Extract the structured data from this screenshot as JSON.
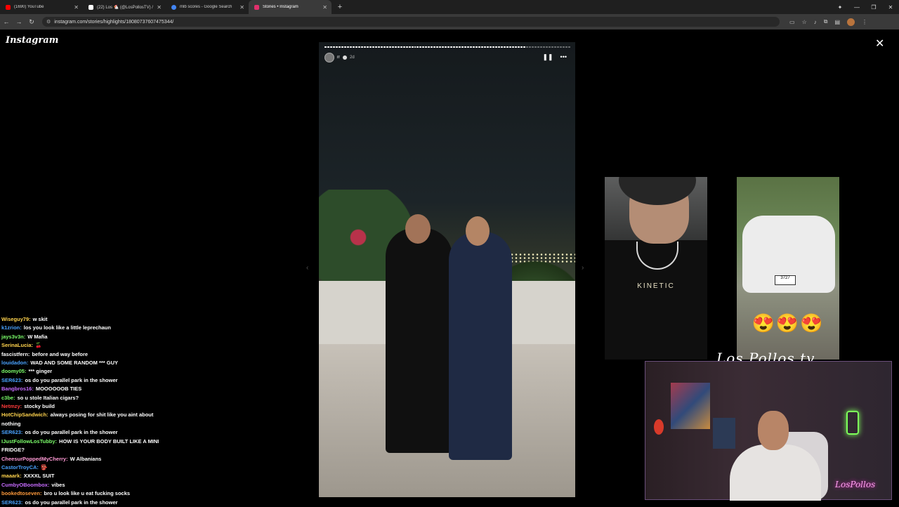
{
  "browser": {
    "tabs": [
      {
        "title": "(1690) YouTube",
        "color": "#ff0000",
        "active": false
      },
      {
        "title": "(22) Los 🐔 (@LosPollosTV) / X",
        "color": "#ffffff",
        "active": false
      },
      {
        "title": "mlb scores - Google Search",
        "color": "#4285f4",
        "active": false
      },
      {
        "title": "Stories • Instagram",
        "color": "#e1306c",
        "active": true
      }
    ],
    "url": "instagram.com/stories/highlights/18080737607475344/"
  },
  "instagram": {
    "logo": "Instagram",
    "story": {
      "username": "rr",
      "time": "2d"
    }
  },
  "previews": {
    "shirt_brand": "KINETIC",
    "plate": "3727",
    "emojis": "😍😍😍"
  },
  "overlay": {
    "signature": "Los Pollos tv",
    "neon_sign": "LosPollos"
  },
  "chat": [
    {
      "user": "Wiseguy79:",
      "text": "w skit",
      "color": "#ffd34d"
    },
    {
      "user": "k1zrion:",
      "text": "los you look like a little leprechaun",
      "color": "#4aa3ff"
    },
    {
      "user": "jays3v3n:",
      "text": "W Mafia",
      "color": "#7cff6b"
    },
    {
      "user": "SerinaLucia:",
      "text": "🍒",
      "color": "#ffd34d"
    },
    {
      "user": "fascistfern:",
      "text": "before and way before",
      "color": "#ffffff"
    },
    {
      "user": "louidadon:",
      "text": "WAD AND SOME RANDOM *** GUY",
      "color": "#4aa3ff"
    },
    {
      "user": "doomy05:",
      "text": "*** ginger",
      "color": "#7cff6b"
    },
    {
      "user": "SER623:",
      "text": "os do you parallel park in the shower",
      "color": "#4aa3ff"
    },
    {
      "user": "Bangbros16:",
      "text": "MOOOOOOB TIES",
      "color": "#c76bff"
    },
    {
      "user": "c3be:",
      "text": "so u stole Italian cigars?",
      "color": "#7cff6b"
    },
    {
      "user": "Netmzy:",
      "text": "stocky build",
      "color": "#ff3b3b"
    },
    {
      "user": "HotChipSandwich:",
      "text": "always posing for shit like you aint about nothing",
      "color": "#ffd34d"
    },
    {
      "user": "SER623:",
      "text": "os do you parallel park in the shower",
      "color": "#4aa3ff"
    },
    {
      "user": "IJustFollowLosTubby:",
      "text": "HOW IS YOUR BODY BUILT LIKE A MINI FRIDGE?",
      "color": "#7cff6b"
    },
    {
      "user": "CheesurPoppedMyCherry:",
      "text": "W Albanians",
      "color": "#ff9ad5"
    },
    {
      "user": "CastorTroyCA:",
      "text": "👺",
      "color": "#4aa3ff"
    },
    {
      "user": "maaark:",
      "text": "XXXXL SUIT",
      "color": "#ffd34d"
    },
    {
      "user": "CumbyOBoombox:",
      "text": "vibes",
      "color": "#c76bff"
    },
    {
      "user": "bookedtoseven:",
      "text": "bro u look like u eat fucking socks",
      "color": "#ff9a3b"
    },
    {
      "user": "SER623:",
      "text": "os do you parallel park in the shower",
      "color": "#4aa3ff"
    }
  ]
}
